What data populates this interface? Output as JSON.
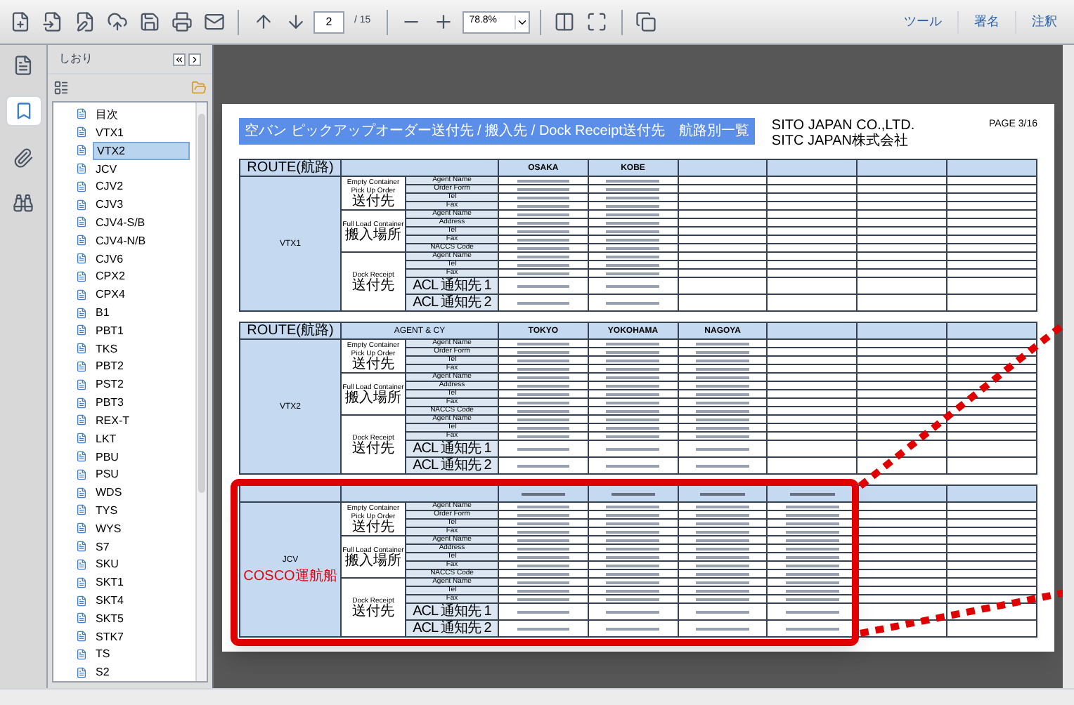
{
  "toolbar": {
    "page_number": "2",
    "page_total": "/ 15",
    "zoom": "78.8%",
    "links": [
      "ツール",
      "署名",
      "注釈"
    ]
  },
  "sidebar": {
    "title": "しおり",
    "bookmarks": [
      {
        "label": "目次",
        "selected": false
      },
      {
        "label": "VTX1",
        "selected": false
      },
      {
        "label": "VTX2",
        "selected": true
      },
      {
        "label": "JCV",
        "selected": false
      },
      {
        "label": "CJV2",
        "selected": false
      },
      {
        "label": "CJV3",
        "selected": false
      },
      {
        "label": "CJV4-S/B",
        "selected": false
      },
      {
        "label": "CJV4-N/B",
        "selected": false
      },
      {
        "label": "CJV6",
        "selected": false
      },
      {
        "label": "CPX2",
        "selected": false
      },
      {
        "label": "CPX4",
        "selected": false
      },
      {
        "label": "B1",
        "selected": false
      },
      {
        "label": "PBT1",
        "selected": false
      },
      {
        "label": "TKS",
        "selected": false
      },
      {
        "label": "PBT2",
        "selected": false
      },
      {
        "label": "PST2",
        "selected": false
      },
      {
        "label": "PBT3",
        "selected": false
      },
      {
        "label": "REX-T",
        "selected": false
      },
      {
        "label": "LKT",
        "selected": false
      },
      {
        "label": "PBU",
        "selected": false
      },
      {
        "label": "PSU",
        "selected": false
      },
      {
        "label": "WDS",
        "selected": false
      },
      {
        "label": "TYS",
        "selected": false
      },
      {
        "label": "WYS",
        "selected": false
      },
      {
        "label": "S7",
        "selected": false
      },
      {
        "label": "SKU",
        "selected": false
      },
      {
        "label": "SKT1",
        "selected": false
      },
      {
        "label": "SKT4",
        "selected": false
      },
      {
        "label": "SKT5",
        "selected": false
      },
      {
        "label": "STK7",
        "selected": false
      },
      {
        "label": "TS",
        "selected": false
      },
      {
        "label": "S2",
        "selected": false
      }
    ]
  },
  "document": {
    "title": "空バン ピックアップオーダー送付先 / 搬入先 / Dock Receipt送付先　航路別一覧",
    "company": [
      "SITO JAPAN CO.,LTD.",
      "SITC JAPAN株式会社"
    ],
    "page": "PAGE 3/16",
    "sections": [
      {
        "route_header": "ROUTE(航路)",
        "route": "VTX1",
        "highlighted": false,
        "columns": [
          {
            "kind": "named",
            "name": "OSAKA"
          },
          {
            "kind": "named",
            "name": "KOBE"
          }
        ],
        "groups": [
          {
            "label": "Empty Container Pick Up Order",
            "label_ja": "送付先",
            "rows": [
              {
                "label": "Agent Name"
              },
              {
                "label": "Order Form"
              },
              {
                "label": "Tel"
              },
              {
                "label": "Fax"
              }
            ]
          },
          {
            "label": "Full Load Container",
            "label_ja": "搬入場所",
            "rows": [
              {
                "label": "Agent Name"
              },
              {
                "label": "Address"
              },
              {
                "label": "Tel"
              },
              {
                "label": "Fax"
              },
              {
                "label": "NACCS Code"
              }
            ]
          },
          {
            "label": "Dock Receipt",
            "label_ja": "送付先",
            "rows": [
              {
                "label": "Agent Name"
              },
              {
                "label": "Tel"
              },
              {
                "label": "Fax"
              },
              {
                "label": "ACL 通知先 1",
                "kind": "cjk"
              },
              {
                "label": "ACL 通知先 2",
                "kind": "cjk"
              }
            ]
          }
        ]
      },
      {
        "route_header": "ROUTE(航路)",
        "agent_header": "AGENT & CY",
        "route": "VTX2",
        "highlighted": false,
        "columns": [
          {
            "kind": "named",
            "name": "TOKYO"
          },
          {
            "kind": "named",
            "name": "YOKOHAMA"
          },
          {
            "kind": "named",
            "name": "NAGOYA"
          }
        ],
        "groups": [
          {
            "label": "Empty Container Pick Up Order",
            "label_ja": "送付先",
            "rows": [
              {
                "label": "Agent Name"
              },
              {
                "label": "Order Form"
              },
              {
                "label": "Tel"
              },
              {
                "label": "Fax"
              }
            ]
          },
          {
            "label": "Full Load Container",
            "label_ja": "搬入場所",
            "rows": [
              {
                "label": "Agent Name"
              },
              {
                "label": "Address"
              },
              {
                "label": "Tel"
              },
              {
                "label": "Fax"
              },
              {
                "label": "NACCS Code"
              }
            ]
          },
          {
            "label": "Dock Receipt",
            "label_ja": "送付先",
            "rows": [
              {
                "label": "Agent Name"
              },
              {
                "label": "Tel"
              },
              {
                "label": "Fax"
              },
              {
                "label": "ACL 通知先 1",
                "kind": "cjk"
              },
              {
                "label": "ACL 通知先 2",
                "kind": "cjk"
              }
            ]
          }
        ]
      },
      {
        "route": "JCV",
        "route_note": "COSCO運航船",
        "highlighted": true,
        "columns": [
          {
            "kind": "illegible"
          },
          {
            "kind": "illegible"
          },
          {
            "kind": "illegible"
          },
          {
            "kind": "illegible"
          }
        ],
        "groups": [
          {
            "label": "Empty Container Pick Up Order",
            "label_ja": "送付先",
            "rows": [
              {
                "label": "Agent Name"
              },
              {
                "label": "Order Form"
              },
              {
                "label": "Tel"
              },
              {
                "label": "Fax"
              }
            ]
          },
          {
            "label": "Full Load Container",
            "label_ja": "搬入場所",
            "rows": [
              {
                "label": "Agent Name"
              },
              {
                "label": "Address"
              },
              {
                "label": "Tel"
              },
              {
                "label": "Fax"
              },
              {
                "label": "NACCS Code"
              }
            ]
          },
          {
            "label": "Dock Receipt",
            "label_ja": "送付先",
            "rows": [
              {
                "label": "Agent Name"
              },
              {
                "label": "Tel"
              },
              {
                "label": "Fax"
              },
              {
                "label": "ACL 通知先 1",
                "kind": "cjk"
              },
              {
                "label": "ACL 通知先 2",
                "kind": "cjk"
              }
            ]
          }
        ]
      }
    ]
  }
}
